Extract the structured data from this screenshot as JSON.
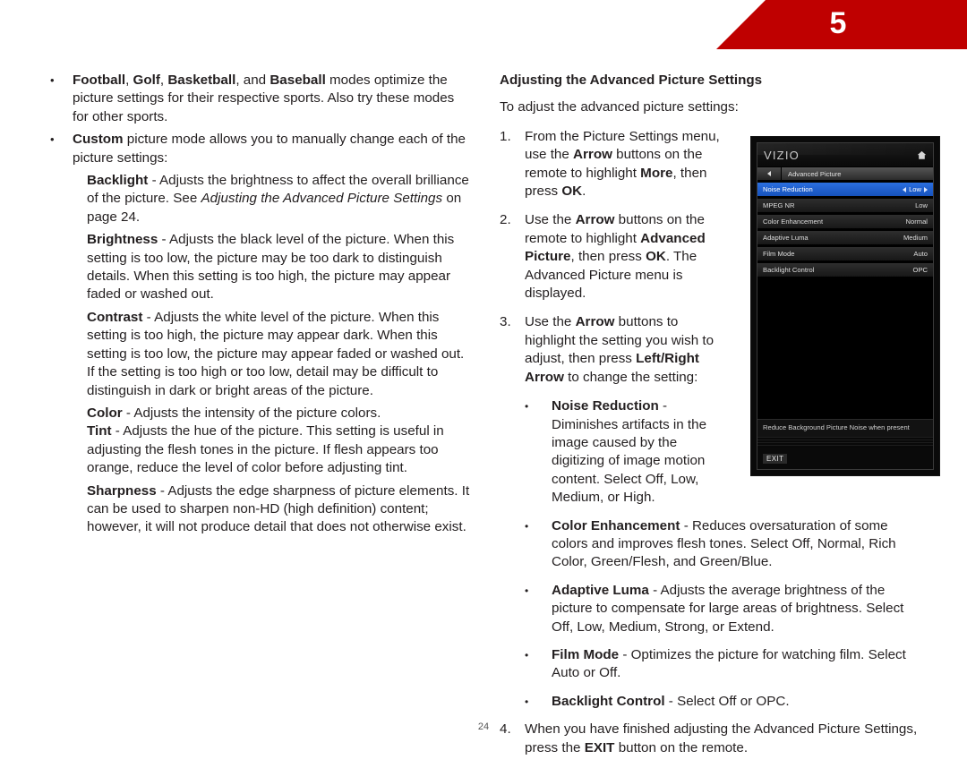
{
  "header": {
    "chapter_number": "5",
    "banner_color": "#bf0000"
  },
  "footer": {
    "page_number": "24"
  },
  "left_column": {
    "bullets": [
      {
        "mark": "•",
        "segments": [
          {
            "text": "Football",
            "style": "bold"
          },
          {
            "text": ", ",
            "style": "normal"
          },
          {
            "text": "Golf",
            "style": "bold"
          },
          {
            "text": ", ",
            "style": "normal"
          },
          {
            "text": "Basketball",
            "style": "bold"
          },
          {
            "text": ", and ",
            "style": "normal"
          },
          {
            "text": "Baseball",
            "style": "bold"
          },
          {
            "text": " modes optimize the picture settings for their respective sports. Also try these modes for other sports.",
            "style": "normal"
          }
        ]
      },
      {
        "mark": "•",
        "segments": [
          {
            "text": "Custom",
            "style": "bold"
          },
          {
            "text": " picture mode allows you to manually change each of the picture settings:",
            "style": "normal"
          }
        ]
      }
    ],
    "settings": [
      {
        "segments": [
          {
            "text": "Backlight",
            "style": "bold"
          },
          {
            "text": " - Adjusts the brightness to affect the overall brilliance of the picture. See ",
            "style": "normal"
          },
          {
            "text": "Adjusting the Advanced Picture Settings",
            "style": "italic"
          },
          {
            "text": " on page 24.",
            "style": "normal"
          }
        ]
      },
      {
        "segments": [
          {
            "text": "Brightness",
            "style": "bold"
          },
          {
            "text": " - Adjusts the black level of the picture. When this setting is too low, the picture may be too dark to distinguish details. When this setting is too high, the picture may appear faded or washed out.",
            "style": "normal"
          }
        ]
      },
      {
        "segments": [
          {
            "text": "Contrast",
            "style": "bold"
          },
          {
            "text": " - Adjusts the white level of the picture. When this setting is too high, the picture may appear dark. When this setting is too low, the picture may appear faded or washed out. If the setting is too high or too low, detail may be difficult to distinguish in dark or bright areas of the picture.",
            "style": "normal"
          }
        ]
      },
      {
        "segments": [
          {
            "text": "Color",
            "style": "bold"
          },
          {
            "text": " - Adjusts the intensity of the picture colors.",
            "style": "normal"
          }
        ]
      },
      {
        "segments": [
          {
            "text": "Tint",
            "style": "bold"
          },
          {
            "text": " - Adjusts the hue of the picture. This setting is useful in adjusting the flesh tones in the picture. If flesh appears too orange, reduce the level of color before adjusting tint.",
            "style": "normal"
          }
        ]
      },
      {
        "segments": [
          {
            "text": "Sharpness",
            "style": "bold"
          },
          {
            "text": " - Adjusts the edge sharpness of picture elements. It can be used to sharpen non-HD (high definition) content; however, it will not produce detail that does not otherwise exist.",
            "style": "normal"
          }
        ]
      }
    ]
  },
  "right_column": {
    "heading": "Adjusting the Advanced Picture Settings",
    "intro": "To adjust the advanced picture settings:",
    "steps": [
      {
        "number": "1.",
        "segments": [
          {
            "text": "From the Picture Settings menu, use the ",
            "style": "normal"
          },
          {
            "text": "Arrow",
            "style": "bold"
          },
          {
            "text": " buttons on the remote to highlight ",
            "style": "normal"
          },
          {
            "text": "More",
            "style": "bold"
          },
          {
            "text": ", then press ",
            "style": "normal"
          },
          {
            "text": "OK",
            "style": "bold"
          },
          {
            "text": ".",
            "style": "normal"
          }
        ]
      },
      {
        "number": "2.",
        "segments": [
          {
            "text": "Use the ",
            "style": "normal"
          },
          {
            "text": "Arrow",
            "style": "bold"
          },
          {
            "text": " buttons on the remote to highlight ",
            "style": "normal"
          },
          {
            "text": "Advanced Picture",
            "style": "bold"
          },
          {
            "text": ", then press ",
            "style": "normal"
          },
          {
            "text": "OK",
            "style": "bold"
          },
          {
            "text": ". The Advanced Picture menu is displayed.",
            "style": "normal"
          }
        ]
      },
      {
        "number": "3.",
        "segments": [
          {
            "text": "Use the ",
            "style": "normal"
          },
          {
            "text": "Arrow",
            "style": "bold"
          },
          {
            "text": " buttons to highlight the setting you wish to adjust, then press ",
            "style": "normal"
          },
          {
            "text": "Left/Right Arrow",
            "style": "bold"
          },
          {
            "text": " to change the setting:",
            "style": "normal"
          }
        ]
      }
    ],
    "sub_bullets": [
      {
        "mark": "•",
        "narrow": true,
        "segments": [
          {
            "text": "Noise Reduction",
            "style": "bold"
          },
          {
            "text": " - Diminishes artifacts in the image caused by the digitizing of image motion content. Select Off, Low, Medium, or High.",
            "style": "normal"
          }
        ]
      },
      {
        "mark": "•",
        "narrow": false,
        "segments": [
          {
            "text": "Color Enhancement",
            "style": "bold"
          },
          {
            "text": " - Reduces oversaturation of some colors and improves flesh tones. Select Off, Normal, Rich Color, Green/Flesh, and Green/Blue.",
            "style": "normal"
          }
        ]
      },
      {
        "mark": "•",
        "narrow": false,
        "segments": [
          {
            "text": "Adaptive Luma",
            "style": "bold"
          },
          {
            "text": " - Adjusts the average brightness of the picture to compensate for large areas of brightness. Select Off, Low, Medium, Strong, or Extend.",
            "style": "normal"
          }
        ]
      },
      {
        "mark": "•",
        "narrow": false,
        "segments": [
          {
            "text": "Film Mode",
            "style": "bold"
          },
          {
            "text": " - Optimizes the picture for watching film. Select Auto or Off.",
            "style": "normal"
          }
        ]
      },
      {
        "mark": "•",
        "narrow": false,
        "segments": [
          {
            "text": "Backlight Control",
            "style": "bold"
          },
          {
            "text": " - Select Off or OPC.",
            "style": "normal"
          }
        ]
      }
    ],
    "final_step": {
      "number": "4.",
      "segments": [
        {
          "text": "When you have finished adjusting the Advanced Picture Settings, press the ",
          "style": "normal"
        },
        {
          "text": "EXIT",
          "style": "bold"
        },
        {
          "text": " button on the remote.",
          "style": "normal"
        }
      ]
    }
  },
  "tv_screenshot": {
    "brand_logo": "VIZIO",
    "home_icon": "home-icon",
    "back_icon": "back-arrow-icon",
    "breadcrumb": "Advanced Picture",
    "rows": [
      {
        "label": "Noise Reduction",
        "value": "Low",
        "selected": true
      },
      {
        "label": "MPEG NR",
        "value": "Low",
        "selected": false
      },
      {
        "label": "Color Enhancement",
        "value": "Normal",
        "selected": false
      },
      {
        "label": "Adaptive Luma",
        "value": "Medium",
        "selected": false
      },
      {
        "label": "Film Mode",
        "value": "Auto",
        "selected": false
      },
      {
        "label": "Backlight Control",
        "value": "OPC",
        "selected": false
      }
    ],
    "help_text": "Reduce Background Picture Noise when present",
    "exit_label": "EXIT",
    "highlight_color": "#2b6fe0"
  }
}
